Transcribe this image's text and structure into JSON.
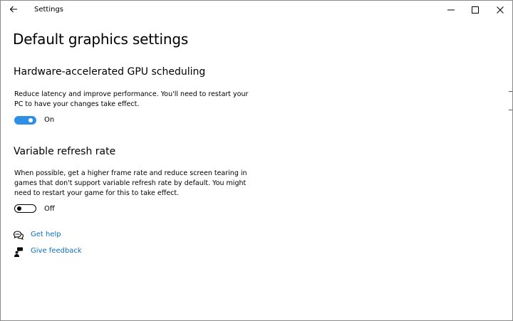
{
  "titlebar": {
    "app_title": "Settings",
    "back_icon": "arrow-left-icon",
    "controls": [
      "minimize-icon",
      "maximize-icon",
      "close-icon"
    ]
  },
  "page": {
    "title": "Default graphics settings"
  },
  "gpu_scheduling": {
    "heading": "Hardware-accelerated GPU scheduling",
    "description": "Reduce latency and improve performance. You'll need to restart your PC to have your changes take effect.",
    "toggle_on": true,
    "toggle_state": "On"
  },
  "variable_refresh": {
    "heading": "Variable refresh rate",
    "description": "When possible, get a higher frame rate and reduce screen tearing in games that don't support variable refresh rate by default. You might need to restart your game for this to take effect.",
    "toggle_on": false,
    "toggle_state": "Off"
  },
  "links": {
    "help": {
      "label": "Get help",
      "icon": "chat-bubbles-icon"
    },
    "feedback": {
      "label": "Give feedback",
      "icon": "person-feedback-icon"
    }
  },
  "colors": {
    "accent": "#2f8fe6",
    "link": "#0a6fc2"
  }
}
